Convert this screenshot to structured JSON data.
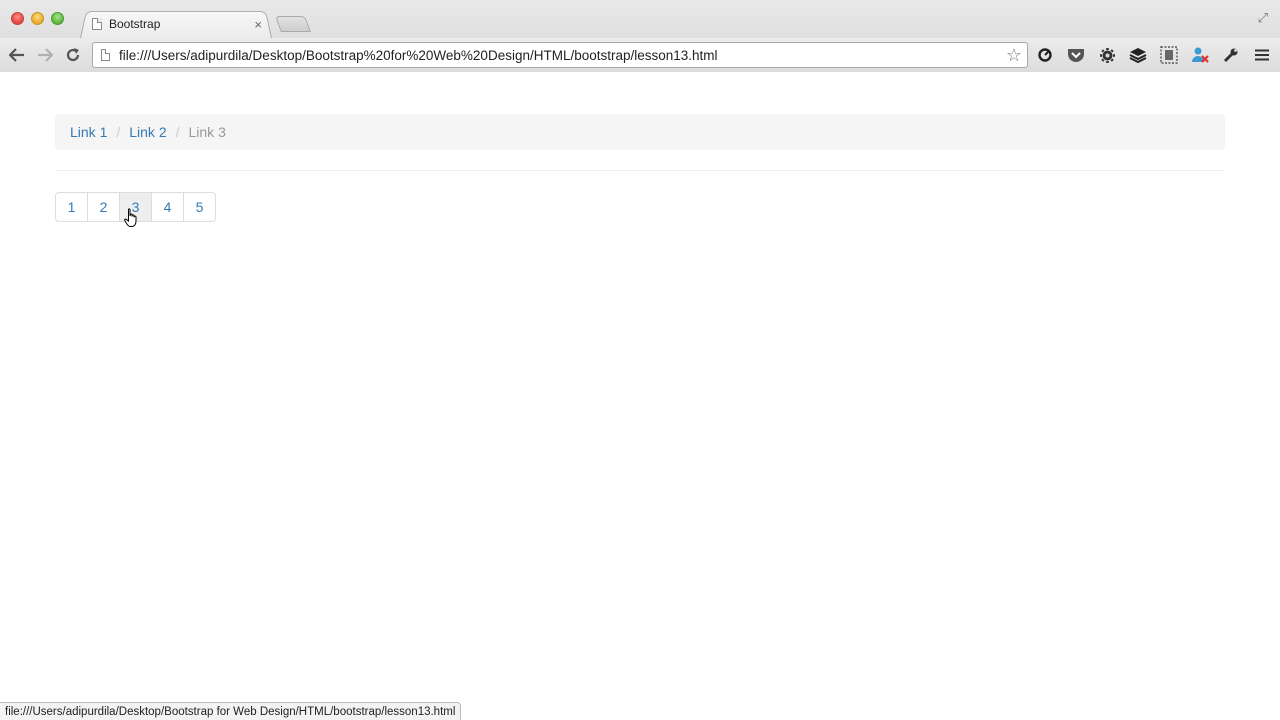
{
  "browser": {
    "tab_title": "Bootstrap",
    "tab_close": "×",
    "url": "file:///Users/adipurdila/Desktop/Bootstrap%20for%20Web%20Design/HTML/bootstrap/lesson13.html",
    "status_text": "file:///Users/adipurdila/Desktop/Bootstrap for Web Design/HTML/bootstrap/lesson13.html",
    "icons": {
      "back": "←",
      "forward": "→",
      "reload": "↻",
      "star": "☆",
      "fullscreen": "⤢",
      "ext1": "⟲",
      "ext2": "⌄",
      "ext3": "⚙",
      "ext4": "≋",
      "ext5": "⧉",
      "ext6": "✕",
      "ext7": "🔧",
      "menu": "≡"
    }
  },
  "breadcrumb": {
    "items": [
      {
        "label": "Link 1"
      },
      {
        "label": "Link 2"
      },
      {
        "label": "Link 3"
      }
    ],
    "separator": "/"
  },
  "pagination": {
    "pages": [
      "1",
      "2",
      "3",
      "4",
      "5"
    ],
    "hovered_page": "3"
  }
}
